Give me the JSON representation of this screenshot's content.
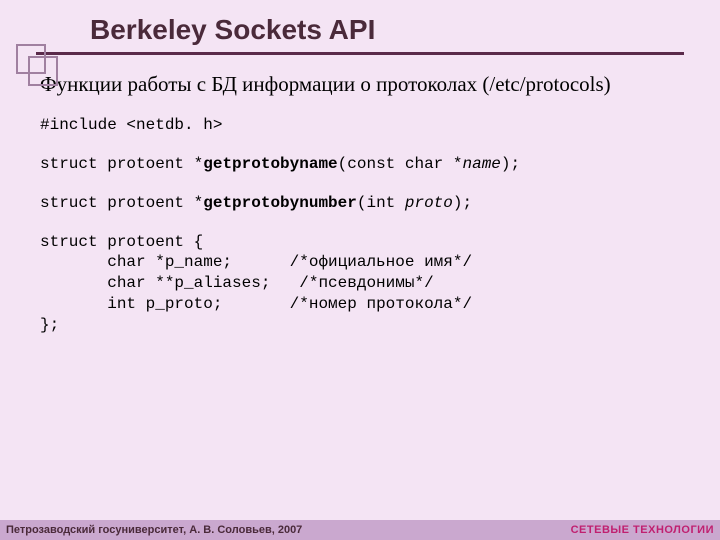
{
  "title": "Berkeley Sockets API",
  "subtitle": "Функции работы с БД информации о протоколах (/etc/protocols)",
  "code": {
    "include": "#include <netdb. h>",
    "fn1_pre": "struct protoent *",
    "fn1_name": "getprotobyname",
    "fn1_arg_open": "(const char *",
    "fn1_arg": "name",
    "fn1_close": ");",
    "fn2_pre": "struct protoent *",
    "fn2_name": "getprotobynumber",
    "fn2_arg_open": "(int ",
    "fn2_arg": "proto",
    "fn2_close": ");",
    "struct_open": "struct protoent {",
    "field1": "       char *p_name;",
    "field1_c": "      /*официальное имя*/",
    "field2": "       char **p_aliases;",
    "field2_c": "   /*псевдонимы*/",
    "field3": "       int p_proto;",
    "field3_c": "       /*номер протокола*/",
    "struct_close": "};"
  },
  "footer": {
    "left": "Петрозаводский госуниверситет, А. В. Соловьев, 2007",
    "right": "СЕТЕВЫЕ ТЕХНОЛОГИИ"
  }
}
